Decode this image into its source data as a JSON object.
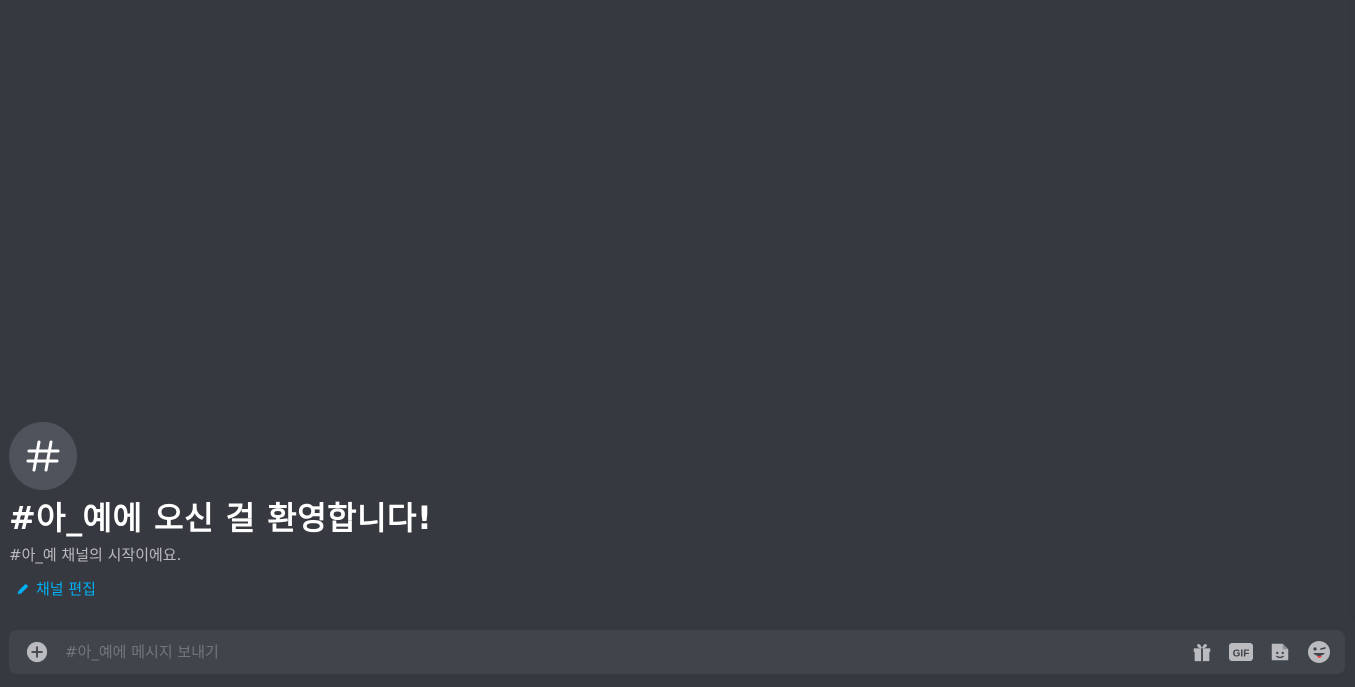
{
  "channel": {
    "icon": "hash-icon",
    "welcome_title": "#아_예에 오신 걸 환영합니다!",
    "welcome_subtitle": "#아_예 채널의 시작이에요.",
    "edit_label": "채널 편집"
  },
  "composer": {
    "placeholder": "#아_예에 메시지 보내기",
    "value": "",
    "icons": [
      "plus-circle-icon",
      "gift-icon",
      "gif-icon",
      "sticker-icon",
      "emoji-icon"
    ]
  },
  "colors": {
    "background": "#36393f",
    "composer_bg": "#40444b",
    "link": "#00aff4",
    "icon_circle": "#4f545c",
    "icon_gray": "#b9bbbe"
  }
}
